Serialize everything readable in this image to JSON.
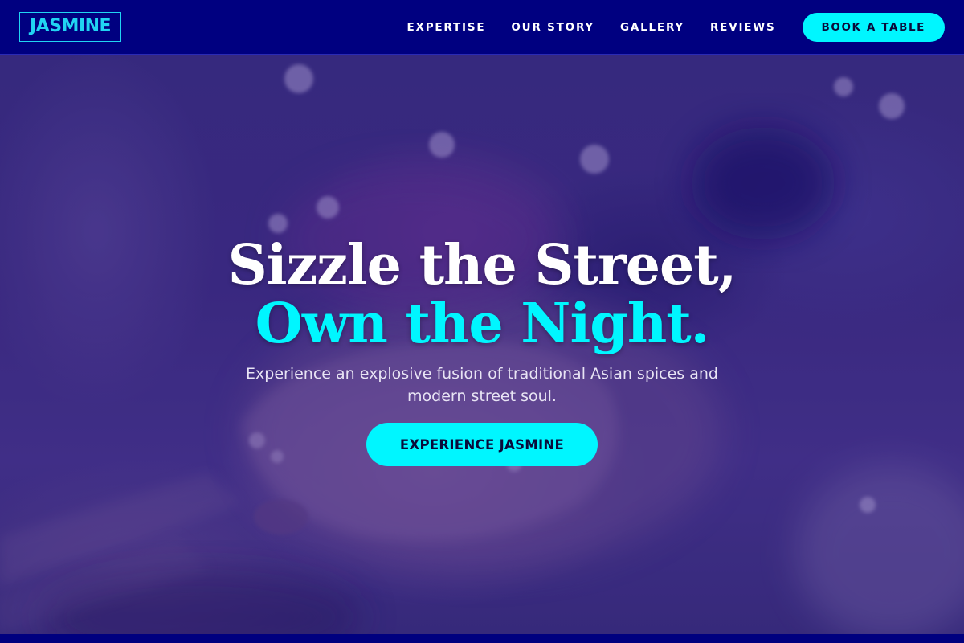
{
  "nav": {
    "logo": "JASMINE",
    "links": [
      "EXPERTISE",
      "OUR STORY",
      "GALLERY",
      "REVIEWS"
    ],
    "book_button": "BOOK A TABLE"
  },
  "hero": {
    "headline_line1": "Sizzle the Street,",
    "headline_line2": "Own the Night.",
    "subtext": "Experience an explosive fusion of traditional Asian spices and modern street soul.",
    "cta_button": "EXPERIENCE JASMINE"
  },
  "colors": {
    "nav_background": "#000080",
    "accent": "#00F6FF",
    "hero_overlay": "#3A2E7E",
    "text_primary": "#FFFFFF"
  }
}
